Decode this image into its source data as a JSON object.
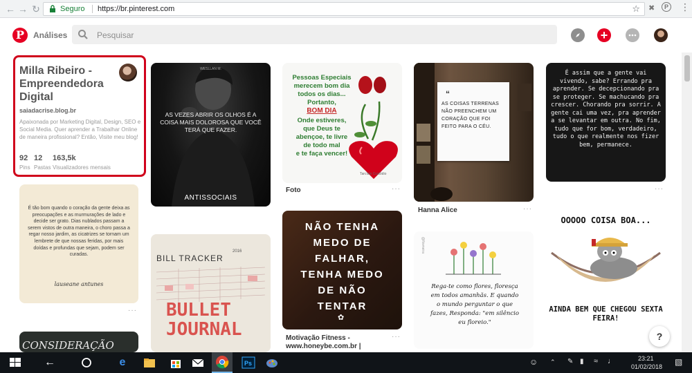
{
  "browser": {
    "secure_label": "Seguro",
    "url": "https://br.pinterest.com"
  },
  "header": {
    "analytics_label": "Análises",
    "search_placeholder": "Pesquisar"
  },
  "profile": {
    "name": "Milla Ribeiro - Empreendedora Digital",
    "domain": "saiadacrise.blog.br",
    "bio": "Apaixonada por Marketing Digital, Design, SEO e Social Media. Quer aprender a Trabalhar Online de maneira profissional? Então, Visite meu blog!",
    "stats": [
      {
        "value": "92",
        "label": "Pins"
      },
      {
        "value": "12",
        "label": "Pastas"
      },
      {
        "value": "163,5k",
        "label": "Visualizadores mensais"
      }
    ]
  },
  "pins": {
    "quote_coracao": {
      "text": "É tão bom quando o coração da gente deixa as preocupações e as murmurações de lado e decide ser grato. Dias nublados passam a serem vistos de outra maneira, o choro passa a regar nosso jardim, as cicatrizes se tornam um lembrete de que nossas feridas, por mais doídas e profundas que sejam, podem ser curadas.",
      "signature": "lauseane antunes"
    },
    "consideracao": {
      "text": "CONSIDERAÇÃO"
    },
    "antissociais": {
      "text": "AS VEZES ABRIR OS OLHOS É A COISA MAIS DOLOROSA QUE VOCÊ TERÁ QUE FAZER.",
      "footer": "ANTISSOCIAIS",
      "credit": "WESLLAN M."
    },
    "bullet": {
      "title": "BILL TRACKER",
      "year": "2016",
      "big": [
        "BULLET",
        "JOURNAL"
      ]
    },
    "rosas": {
      "lines": [
        "Pessoas Especiais",
        "merecem bom dia",
        "todos os dias...",
        "Portanto,",
        "BOM DIA",
        "Onde estiveres,",
        "que Deus te",
        "abençoe, te livre",
        "de todo mal",
        "e te faça vencer!"
      ],
      "credit": "Tarcísio Custódio",
      "caption": "Foto"
    },
    "nao_tenha": {
      "lines": [
        "NÃO TENHA",
        "MEDO DE",
        "FALHAR,",
        "TENHA MEDO",
        "DE NÃO",
        "TENTAR"
      ],
      "caption": "Motivação Fitness - www.honeybe.com.br |"
    },
    "coisas_terrenas": {
      "text": "AS COISAS TERRENAS NÃO PREENCHEM UM CORAÇÃO QUE FOI FEITO PARA O CÉU.",
      "caption": "Hanna Alice"
    },
    "flores": {
      "text": "Rega-te como flores, floresça em todos amanhãs. E quando o mundo perguntar o que fazes, Responda: \"em silêncio eu floreio.\"",
      "side": "@flovneira"
    },
    "e_assim": {
      "text": "É assim que a gente vai vivendo, sabe? Errando pra aprender. Se decepcionando pra se proteger. Se machucando pra crescer. Chorando pra sorrir. A gente cai uma vez, pra aprender a se levantar em outra. No fim, tudo que for bom, verdadeiro, tudo o que realmente nos fizer bem, permanece."
    },
    "coisa_boa": {
      "top": "OOOOO COISA BOA...",
      "bottom": "AINDA BEM QUE CHEGOU SEXTA FEIRA!"
    }
  },
  "help_label": "?",
  "taskbar": {
    "time": "23:21",
    "date": "01/02/2018"
  }
}
